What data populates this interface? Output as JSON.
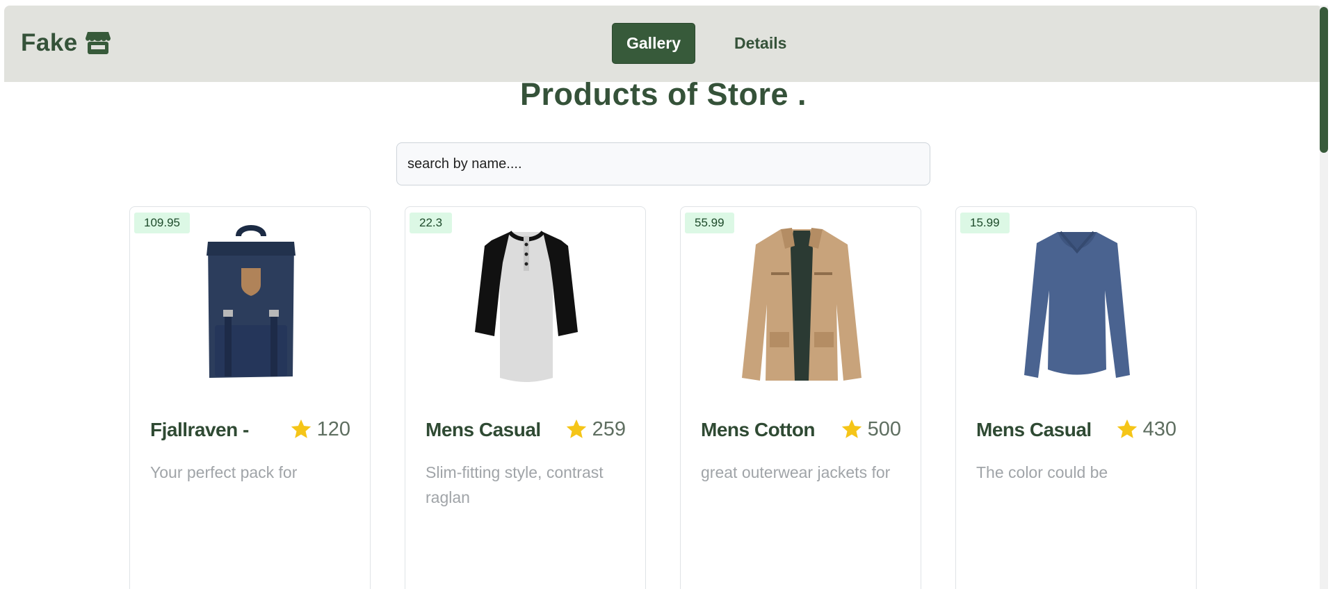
{
  "brand": {
    "name": "Fake",
    "icon": "store-icon"
  },
  "nav": {
    "tabs": [
      {
        "label": "Gallery",
        "active": true
      },
      {
        "label": "Details",
        "active": false
      }
    ]
  },
  "page_title": "Products of Store .",
  "search": {
    "placeholder": "search by name...."
  },
  "products": [
    {
      "price": "109.95",
      "title": "Fjallraven -",
      "rating_count": "120",
      "description": "Your perfect pack for",
      "image": "backpack"
    },
    {
      "price": "22.3",
      "title": "Mens Casual",
      "rating_count": "259",
      "description": "Slim-fitting style, contrast raglan",
      "image": "raglan-shirt"
    },
    {
      "price": "55.99",
      "title": "Mens Cotton",
      "rating_count": "500",
      "description": "great outerwear jackets for",
      "image": "cotton-jacket"
    },
    {
      "price": "15.99",
      "title": "Mens Casual",
      "rating_count": "430",
      "description": "The color could be",
      "image": "long-sleeve-shirt"
    }
  ],
  "colors": {
    "navbar": "#e1e2dd",
    "accent": "#375a3a",
    "badge": "#dcf8e5",
    "star": "#f5c518"
  }
}
